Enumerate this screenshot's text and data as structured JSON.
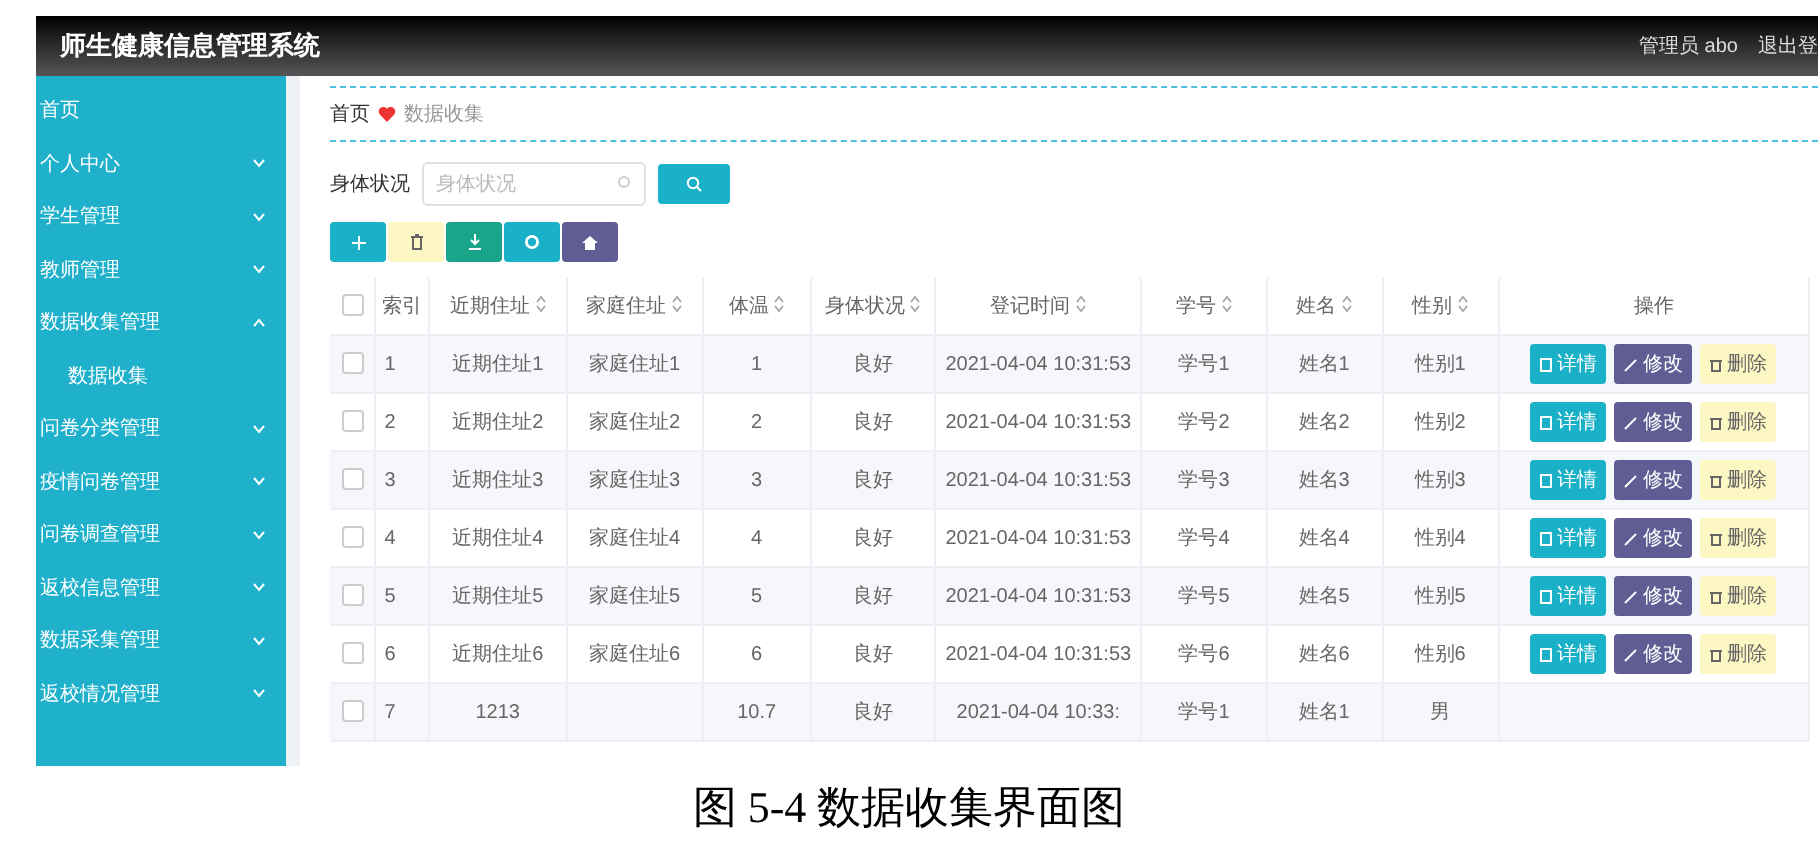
{
  "header": {
    "title": "师生健康信息管理系统",
    "user": "管理员 abo",
    "logout": "退出登"
  },
  "sidebar": {
    "items": [
      {
        "label": "首页"
      },
      {
        "label": "个人中心",
        "expanded": false
      },
      {
        "label": "学生管理",
        "expanded": false
      },
      {
        "label": "教师管理",
        "expanded": false
      },
      {
        "label": "数据收集管理",
        "expanded": true,
        "children": [
          {
            "label": "数据收集"
          }
        ]
      },
      {
        "label": "问卷分类管理",
        "expanded": false
      },
      {
        "label": "疫情问卷管理",
        "expanded": false
      },
      {
        "label": "问卷调查管理",
        "expanded": false
      },
      {
        "label": "返校信息管理",
        "expanded": false
      },
      {
        "label": "数据采集管理",
        "expanded": false
      },
      {
        "label": "返校情况管理",
        "expanded": false
      }
    ]
  },
  "breadcrumb": [
    "首页",
    "数据收集"
  ],
  "search": {
    "label": "身体状况",
    "placeholder": "身体状况"
  },
  "toolbar": [
    {
      "kind": "add",
      "color": "#1ab0c8"
    },
    {
      "kind": "delete",
      "color": "#fdf7c3"
    },
    {
      "kind": "export",
      "color": "#19a589"
    },
    {
      "kind": "settings",
      "color": "#1ab0c8"
    },
    {
      "kind": "upload",
      "color": "#5f5d94"
    }
  ],
  "table": {
    "columns": [
      {
        "label": "索引",
        "sortable": false
      },
      {
        "label": "近期住址",
        "sortable": true
      },
      {
        "label": "家庭住址",
        "sortable": true
      },
      {
        "label": "体温",
        "sortable": true
      },
      {
        "label": "身体状况",
        "sortable": true
      },
      {
        "label": "登记时间",
        "sortable": true
      },
      {
        "label": "学号",
        "sortable": true
      },
      {
        "label": "姓名",
        "sortable": true
      },
      {
        "label": "性别",
        "sortable": true
      },
      {
        "label": "操作",
        "sortable": false
      }
    ],
    "all_checked": false,
    "rows": [
      {
        "checked": false,
        "cells": [
          "1",
          "近期住址1",
          "家庭住址1",
          "1",
          "良好",
          "2021-04-04 10:31:53",
          "学号1",
          "姓名1",
          "性别1"
        ],
        "actions": [
          "详情",
          "修改",
          "删除"
        ]
      },
      {
        "checked": false,
        "cells": [
          "2",
          "近期住址2",
          "家庭住址2",
          "2",
          "良好",
          "2021-04-04 10:31:53",
          "学号2",
          "姓名2",
          "性别2"
        ],
        "actions": [
          "详情",
          "修改",
          "删除"
        ]
      },
      {
        "checked": false,
        "cells": [
          "3",
          "近期住址3",
          "家庭住址3",
          "3",
          "良好",
          "2021-04-04 10:31:53",
          "学号3",
          "姓名3",
          "性别3"
        ],
        "actions": [
          "详情",
          "修改",
          "删除"
        ]
      },
      {
        "checked": false,
        "cells": [
          "4",
          "近期住址4",
          "家庭住址4",
          "4",
          "良好",
          "2021-04-04 10:31:53",
          "学号4",
          "姓名4",
          "性别4"
        ],
        "actions": [
          "详情",
          "修改",
          "删除"
        ]
      },
      {
        "checked": false,
        "cells": [
          "5",
          "近期住址5",
          "家庭住址5",
          "5",
          "良好",
          "2021-04-04 10:31:53",
          "学号5",
          "姓名5",
          "性别5"
        ],
        "actions": [
          "详情",
          "修改",
          "删除"
        ]
      },
      {
        "checked": false,
        "cells": [
          "6",
          "近期住址6",
          "家庭住址6",
          "6",
          "良好",
          "2021-04-04 10:31:53",
          "学号6",
          "姓名6",
          "性别6"
        ],
        "actions": [
          "详情",
          "修改",
          "删除"
        ]
      },
      {
        "checked": false,
        "cells": [
          "7",
          "1213",
          "",
          "10.7",
          "良好",
          "2021-04-04 10:33:",
          "学号1",
          "姓名1",
          "男"
        ]
      }
    ]
  },
  "caption": "图 5-4 数据收集界面图"
}
